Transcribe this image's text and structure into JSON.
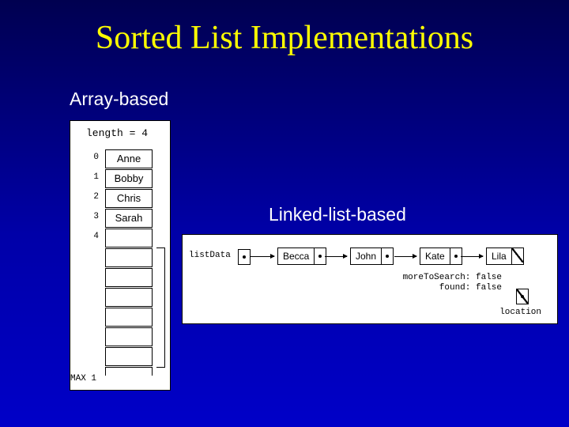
{
  "title": "Sorted List Implementations",
  "labels": {
    "array": "Array-based",
    "linked": "Linked-list-based"
  },
  "array": {
    "length_label": "length = 4",
    "indices": [
      "0",
      "1",
      "2",
      "3",
      "4"
    ],
    "cells": [
      "Anne",
      "Bobby",
      "Chris",
      "Sarah"
    ],
    "max_label": "MAX 1"
  },
  "linked": {
    "listdata_label": "listData",
    "nodes": [
      "Becca",
      "John",
      "Kate",
      "Lila"
    ],
    "flags_line1": "moreToSearch: false",
    "flags_line2": "found:        false",
    "location_label": "location"
  }
}
